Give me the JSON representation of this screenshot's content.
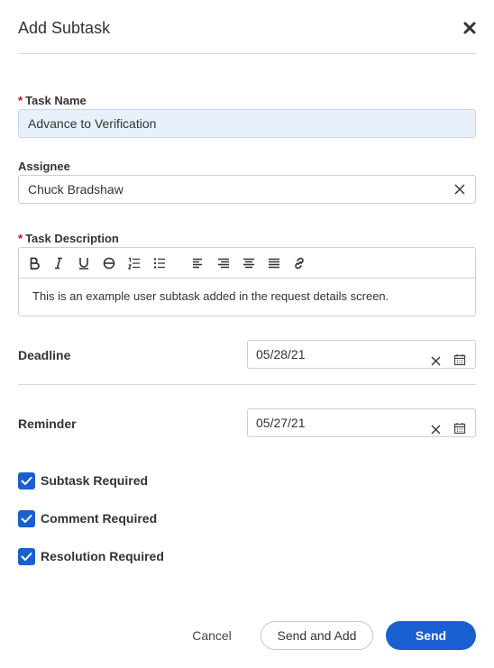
{
  "dialog": {
    "title": "Add Subtask"
  },
  "task_name": {
    "label": "Task Name",
    "required_marker": "*",
    "value": "Advance to Verification"
  },
  "assignee": {
    "label": "Assignee",
    "value": "Chuck Bradshaw"
  },
  "description": {
    "label": "Task Description",
    "required_marker": "*",
    "toolbar": [
      "bold-icon",
      "italic-icon",
      "underline-icon",
      "strikethrough-icon",
      "ordered-list-icon",
      "bullet-list-icon",
      "align-left-icon",
      "align-center-icon",
      "align-right-icon",
      "align-justify-icon",
      "link-icon"
    ],
    "text": "This is an example user subtask added in the request details screen."
  },
  "deadline": {
    "label": "Deadline",
    "value": "05/28/21"
  },
  "reminder": {
    "label": "Reminder",
    "value": "05/27/21"
  },
  "checkboxes": [
    {
      "label": "Subtask Required",
      "checked": true
    },
    {
      "label": "Comment Required",
      "checked": true
    },
    {
      "label": "Resolution Required",
      "checked": true
    }
  ],
  "buttons": {
    "cancel": "Cancel",
    "send_and_add": "Send and Add",
    "send": "Send"
  },
  "colors": {
    "primary": "#1a5fd0",
    "required": "#d0021b",
    "filled_input": "#e8f0fc"
  }
}
